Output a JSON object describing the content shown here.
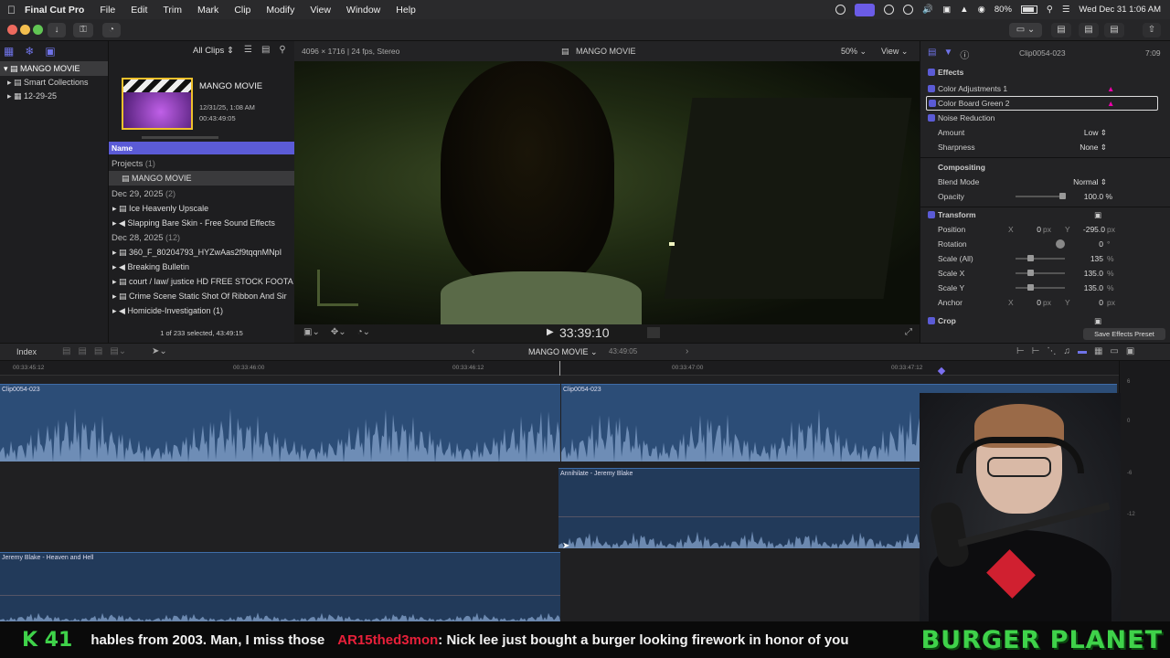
{
  "menubar": {
    "app": "Final Cut Pro",
    "items": [
      "File",
      "Edit",
      "Trim",
      "Mark",
      "Clip",
      "Modify",
      "View",
      "Window",
      "Help"
    ],
    "battery": "80%",
    "datetime": "Wed Dec 31  1:06 AM"
  },
  "browser": {
    "filter": "All Clips",
    "sidebar": [
      {
        "label": "MANGO MOVIE",
        "selected": true
      },
      {
        "label": "Smart Collections"
      },
      {
        "label": "12-29-25"
      }
    ],
    "project_card": {
      "title": "MANGO MOVIE",
      "date": "12/31/25, 1:08 AM",
      "duration": "00:43:49:05",
      "counter": "1 of 233 selected, 43:49:15"
    },
    "column_header": "Name",
    "projects_label": "Projects",
    "projects_count": "(1)",
    "project_item": "MANGO MOVIE",
    "group1_date": "Dec 29, 2025",
    "group1_count": "(2)",
    "group1_items": [
      "Ice Heavenly Upscale",
      "Slapping Bare Skin - Free Sound Effects"
    ],
    "group2_date": "Dec 28, 2025",
    "group2_count": "(12)",
    "group2_items": [
      "360_F_80204793_HYZwAas2f9tqqnMNpI",
      "Breaking Bulletin",
      "court / law/ justice HD FREE STOCK FOOTA",
      "Crime Scene Static Shot Of Ribbon And Sir",
      "Homicide-Investigation (1)"
    ]
  },
  "viewer": {
    "format": "4096 × 1716 | 24 fps, Stereo",
    "title": "MANGO MOVIE",
    "zoom": "50%",
    "view": "View",
    "timecode": "33:39:10"
  },
  "inspector": {
    "clip": "Clip0054-023",
    "duration": "7:09",
    "effects": "Effects",
    "color_adj": "Color Adjustments 1",
    "color_board": "Color Board Green 2",
    "noise": "Noise Reduction",
    "amount_label": "Amount",
    "amount": "Low",
    "sharpness_label": "Sharpness",
    "sharpness": "None",
    "compositing": "Compositing",
    "blend_label": "Blend Mode",
    "blend": "Normal",
    "opacity_label": "Opacity",
    "opacity": "100.0",
    "transform": "Transform",
    "position_label": "Position",
    "pos_x": "0",
    "pos_y": "-295.0",
    "rotation_label": "Rotation",
    "rotation": "0",
    "scale_all_label": "Scale (All)",
    "scale_all": "135",
    "scale_x_label": "Scale X",
    "scale_x": "135.0",
    "scale_y_label": "Scale Y",
    "scale_y": "135.0",
    "anchor_label": "Anchor",
    "anchor_x": "0",
    "anchor_y": "0",
    "crop": "Crop",
    "save_preset": "Save Effects Preset",
    "unit_px": "px",
    "unit_pct": "%",
    "unit_deg": "°",
    "lx": "X",
    "ly": "Y"
  },
  "timeline": {
    "index": "Index",
    "project": "MANGO MOVIE",
    "duration": "43:49:05",
    "ruler": [
      "00:33:45:12",
      "00:33:46:00",
      "00:33:46:12",
      "00:33:47:00",
      "00:33:47:12"
    ],
    "clips": [
      "Clip0054-023",
      "Clip0054-023",
      "Annihilate - Jeremy Blake",
      "Jeremy Blake - Heaven and Hell"
    ],
    "meter": [
      "6",
      "0",
      "-6",
      "-12"
    ]
  },
  "ticker": {
    "prefix": "K 41",
    "text1": "hables from 2003. Man, I miss those",
    "user": "AR15thed3mon",
    "text2": ": Nick lee just bought a burger looking firework in honor of you",
    "brand": "BURGER PLANET"
  },
  "colors": {
    "accent": "#5b5bd6",
    "clip": "#2c4d77",
    "ticker_green": "#3fd24a",
    "ticker_red": "#e8203a"
  }
}
